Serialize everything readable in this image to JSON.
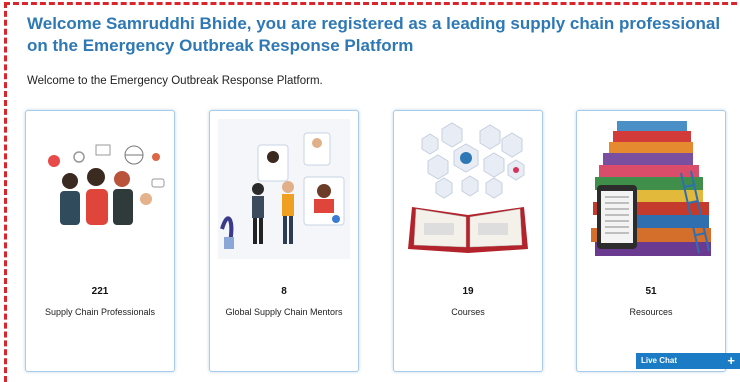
{
  "header": {
    "title": "Welcome Samruddhi Bhide, you are registered as a leading supply chain professional on the Emergency Outbreak Response Platform",
    "intro": "Welcome to the Emergency Outbreak Response Platform."
  },
  "cards": [
    {
      "count": "221",
      "label": "Supply Chain Professionals",
      "icon": "team-illustration"
    },
    {
      "count": "8",
      "label": "Global Supply Chain Mentors",
      "icon": "mentor-illustration"
    },
    {
      "count": "19",
      "label": "Courses",
      "icon": "open-book-illustration"
    },
    {
      "count": "51",
      "label": "Resources",
      "icon": "book-stack-illustration"
    }
  ],
  "live_chat": {
    "label": "Live Chat",
    "icon": "plus"
  },
  "colors": {
    "accent": "#2e79b5",
    "frame": "#d9262c",
    "chat": "#1b7bc4"
  }
}
